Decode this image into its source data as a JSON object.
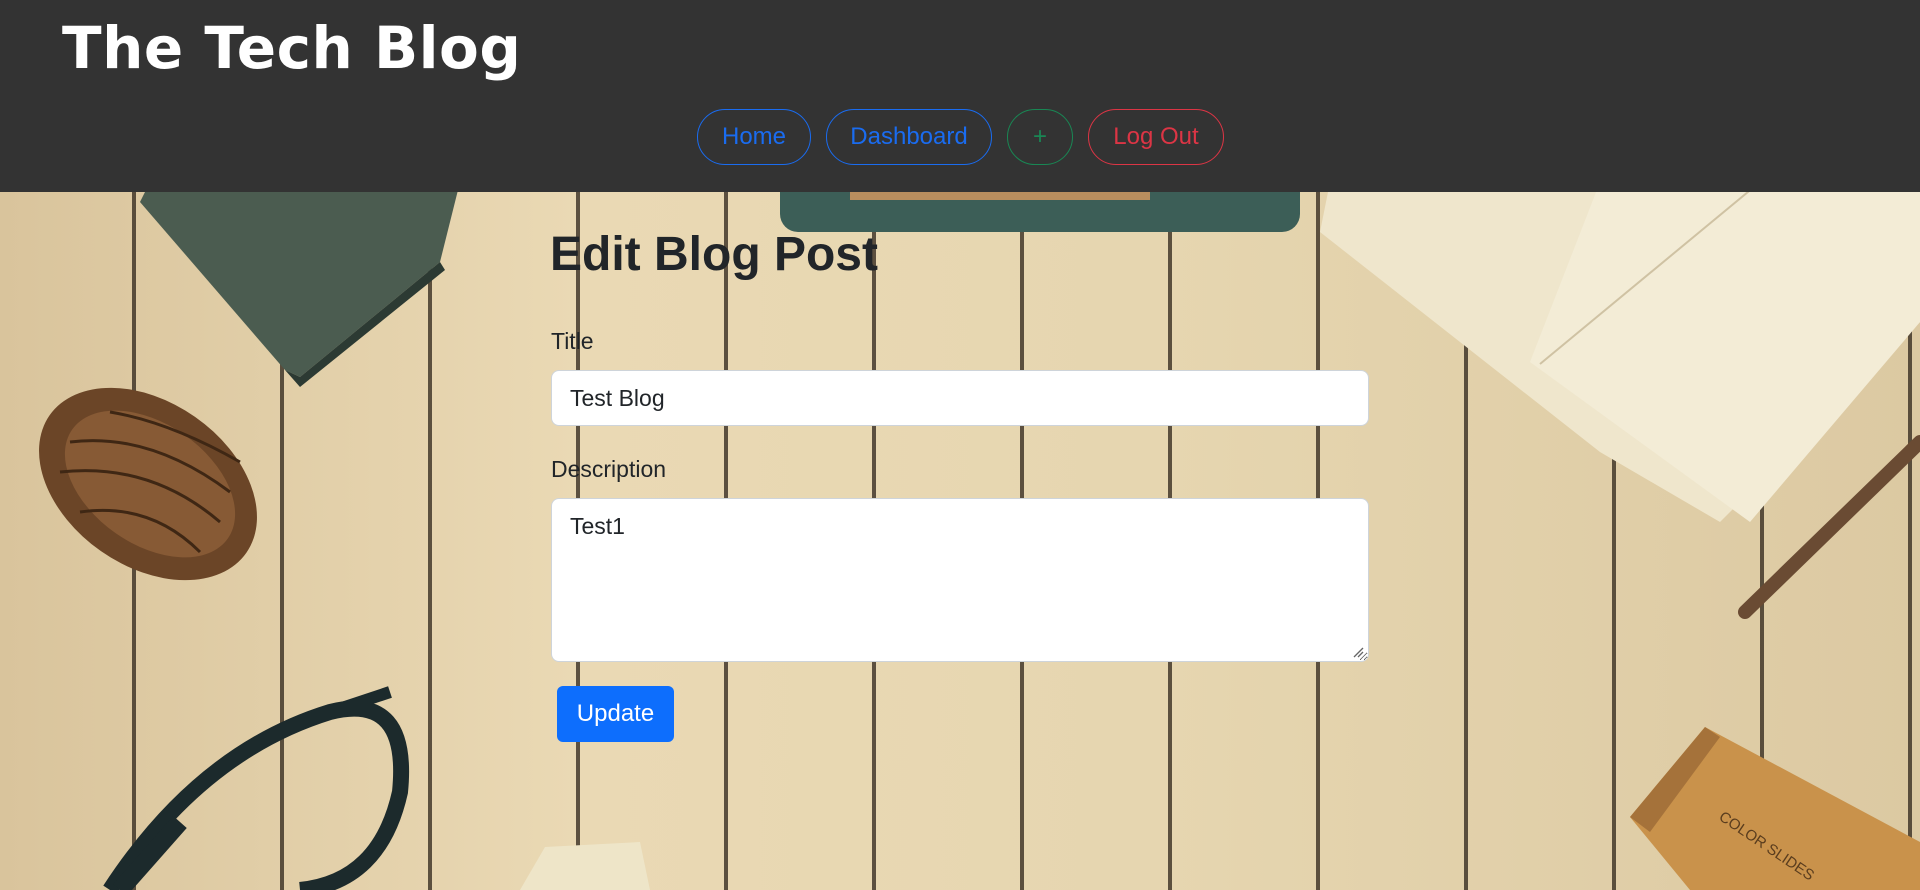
{
  "header": {
    "brand": "The Tech Blog",
    "nav": {
      "home": "Home",
      "dashboard": "Dashboard",
      "add": "+",
      "logout": "Log Out"
    }
  },
  "form": {
    "heading": "Edit Blog Post",
    "title_label": "Title",
    "title_value": "Test Blog",
    "description_label": "Description",
    "description_value": "Test1",
    "submit_label": "Update"
  },
  "background": {
    "box_text": "COLOR SLIDES"
  },
  "colors": {
    "header_bg": "#333333",
    "primary": "#0d6efd",
    "success": "#198754",
    "danger": "#dc3545"
  }
}
